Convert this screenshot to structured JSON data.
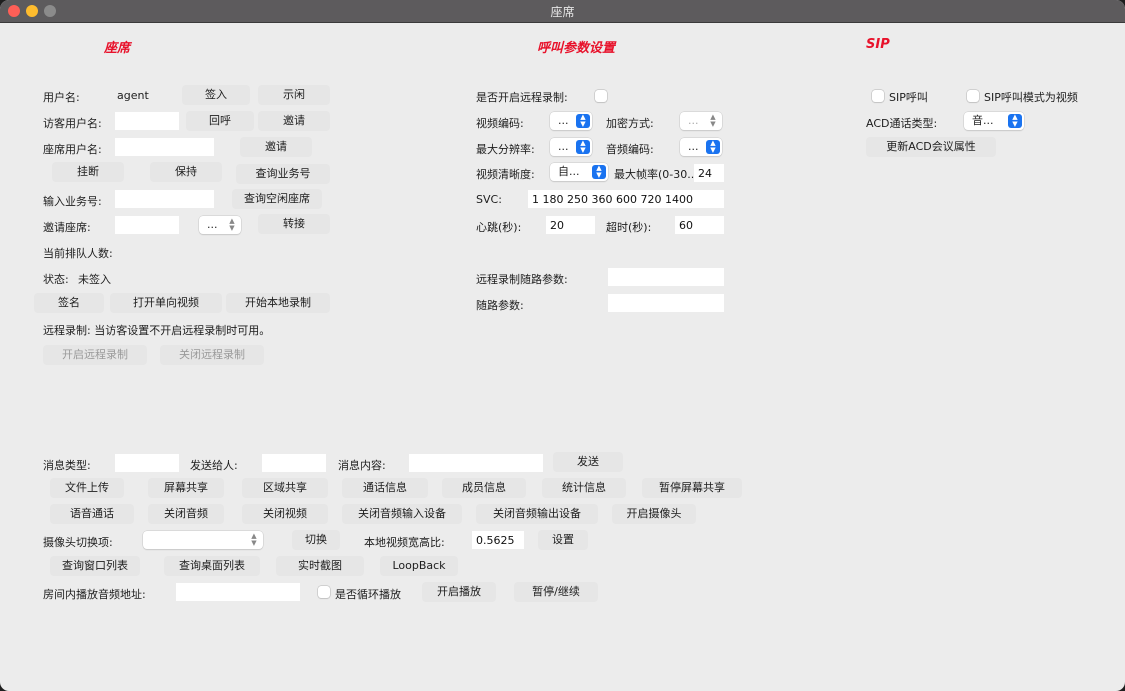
{
  "window": {
    "title": "座席"
  },
  "sections": {
    "agent": "座席",
    "call_params": "呼叫参数设置",
    "sip": "SIP"
  },
  "agent": {
    "username_label": "用户名:",
    "username_value": "agent",
    "sign_in": "签入",
    "idle": "示闲",
    "visitor_username_label": "访客用户名:",
    "callback": "回呼",
    "invite1": "邀请",
    "agent_username_label": "座席用户名:",
    "invite2": "邀请",
    "hangup": "挂断",
    "hold": "保持",
    "query_business": "查询业务号",
    "input_business_label": "输入业务号:",
    "query_idle_agent": "查询空闲座席",
    "invite_agent_label": "邀请座席:",
    "invite_agent_select": "...",
    "transfer": "转接",
    "queue_label": "当前排队人数:",
    "status_label": "状态:",
    "status_value": "未签入",
    "sign": "签名",
    "open_oneway_video": "打开单向视频",
    "start_local_record": "开始本地录制",
    "remote_record_note": "远程录制: 当访客设置不开启远程录制时可用。",
    "start_remote_record": "开启远程录制",
    "stop_remote_record": "关闭远程录制"
  },
  "call": {
    "enable_remote_record_label": "是否开启远程录制:",
    "video_codec_label": "视频编码:",
    "video_codec_value": "...",
    "encryption_label": "加密方式:",
    "encryption_value": "...",
    "max_resolution_label": "最大分辨率:",
    "max_resolution_value": "...",
    "audio_codec_label": "音频编码:",
    "audio_codec_value": "...",
    "video_clarity_label": "视频清晰度:",
    "video_clarity_value": "自...",
    "max_fps_label": "最大帧率(0-30..",
    "max_fps_value": "24",
    "svc_label": "SVC:",
    "svc_value": "1 180 250 360 600 720 1400",
    "heartbeat_label": "心跳(秒):",
    "heartbeat_value": "20",
    "timeout_label": "超时(秒):",
    "timeout_value": "60",
    "remote_record_params_label": "远程录制随路参数:",
    "path_params_label": "随路参数:"
  },
  "sip": {
    "sip_call": "SIP呼叫",
    "sip_video_mode": "SIP呼叫模式为视频",
    "acd_type_label": "ACD通话类型:",
    "acd_type_value": "音...",
    "update_acd": "更新ACD会议属性"
  },
  "bottom": {
    "msg_type_label": "消息类型:",
    "send_to_label": "发送给人:",
    "msg_content_label": "消息内容:",
    "send": "发送",
    "file_upload": "文件上传",
    "screen_share": "屏幕共享",
    "region_share": "区域共享",
    "call_info": "通话信息",
    "member_info": "成员信息",
    "stats_info": "统计信息",
    "pause_screen_share": "暂停屏幕共享",
    "voice_call": "语音通话",
    "close_audio": "关闭音频",
    "close_video": "关闭视频",
    "close_audio_input": "关闭音频输入设备",
    "close_audio_output": "关闭音频输出设备",
    "open_camera": "开启摄像头",
    "camera_switch_label": "摄像头切换项:",
    "switch": "切换",
    "local_ratio_label": "本地视频宽高比:",
    "local_ratio_value": "0.5625",
    "set": "设置",
    "query_windows": "查询窗口列表",
    "query_desktops": "查询桌面列表",
    "snapshot": "实时截图",
    "loopback": "LoopBack",
    "room_audio_label": "房间内播放音频地址:",
    "loop_play_label": "是否循环播放",
    "start_play": "开启播放",
    "pause_resume": "暂停/继续"
  }
}
